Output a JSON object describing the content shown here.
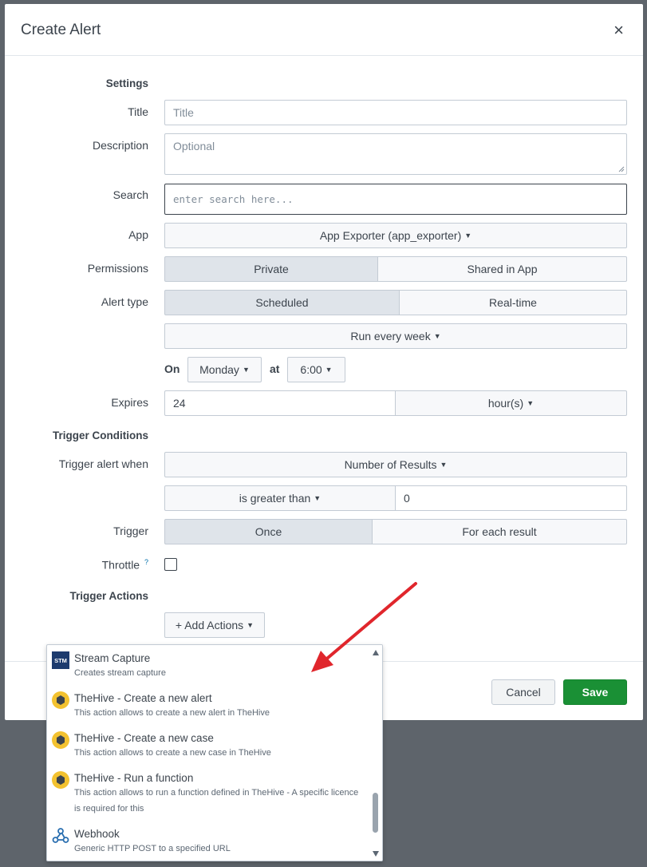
{
  "dialog": {
    "title": "Create Alert",
    "close_glyph": "×"
  },
  "settings": {
    "heading": "Settings",
    "title_label": "Title",
    "title_placeholder": "Title",
    "description_label": "Description",
    "description_placeholder": "Optional",
    "search_label": "Search",
    "search_placeholder": "enter search here...",
    "app_label": "App",
    "app_value": "App Exporter (app_exporter)",
    "permissions_label": "Permissions",
    "permissions_options": [
      "Private",
      "Shared in App"
    ],
    "permissions_selected": "Private",
    "alert_type_label": "Alert type",
    "alert_type_options": [
      "Scheduled",
      "Real-time"
    ],
    "alert_type_selected": "Scheduled",
    "schedule_value": "Run every week",
    "on_label": "On",
    "day_value": "Monday",
    "at_label": "at",
    "time_value": "6:00",
    "expires_label": "Expires",
    "expires_value": "24",
    "expires_unit": "hour(s)"
  },
  "trigger_conditions": {
    "heading": "Trigger Conditions",
    "trigger_when_label": "Trigger alert when",
    "trigger_when_value": "Number of Results",
    "comparison_value": "is greater than",
    "threshold_value": "0",
    "trigger_label": "Trigger",
    "trigger_options": [
      "Once",
      "For each result"
    ],
    "trigger_selected": "Once",
    "throttle_label": "Throttle",
    "throttle_help": "?",
    "throttle_checked": false
  },
  "trigger_actions": {
    "heading": "Trigger Actions",
    "add_actions_label": "+ Add Actions"
  },
  "actions_menu": {
    "items": [
      {
        "title": "Stream Capture",
        "description": "Creates stream capture",
        "icon": "stream-capture-icon",
        "icon_text": "STM"
      },
      {
        "title": "TheHive - Create a new alert",
        "description": "This action allows to create a new alert in TheHive",
        "icon": "thehive-icon"
      },
      {
        "title": "TheHive - Create a new case",
        "description": "This action allows to create a new case in TheHive",
        "icon": "thehive-icon"
      },
      {
        "title": "TheHive - Run a function",
        "description": "This action allows to run a function defined in TheHive - A specific licence is required for this",
        "icon": "thehive-icon"
      },
      {
        "title": "Webhook",
        "description": "Generic HTTP POST to a specified URL",
        "icon": "webhook-icon"
      }
    ]
  },
  "footer": {
    "cancel_label": "Cancel",
    "save_label": "Save"
  },
  "colors": {
    "save_green": "#1a9035",
    "annotation_arrow": "#e0262c",
    "backdrop": "#5e646b"
  }
}
